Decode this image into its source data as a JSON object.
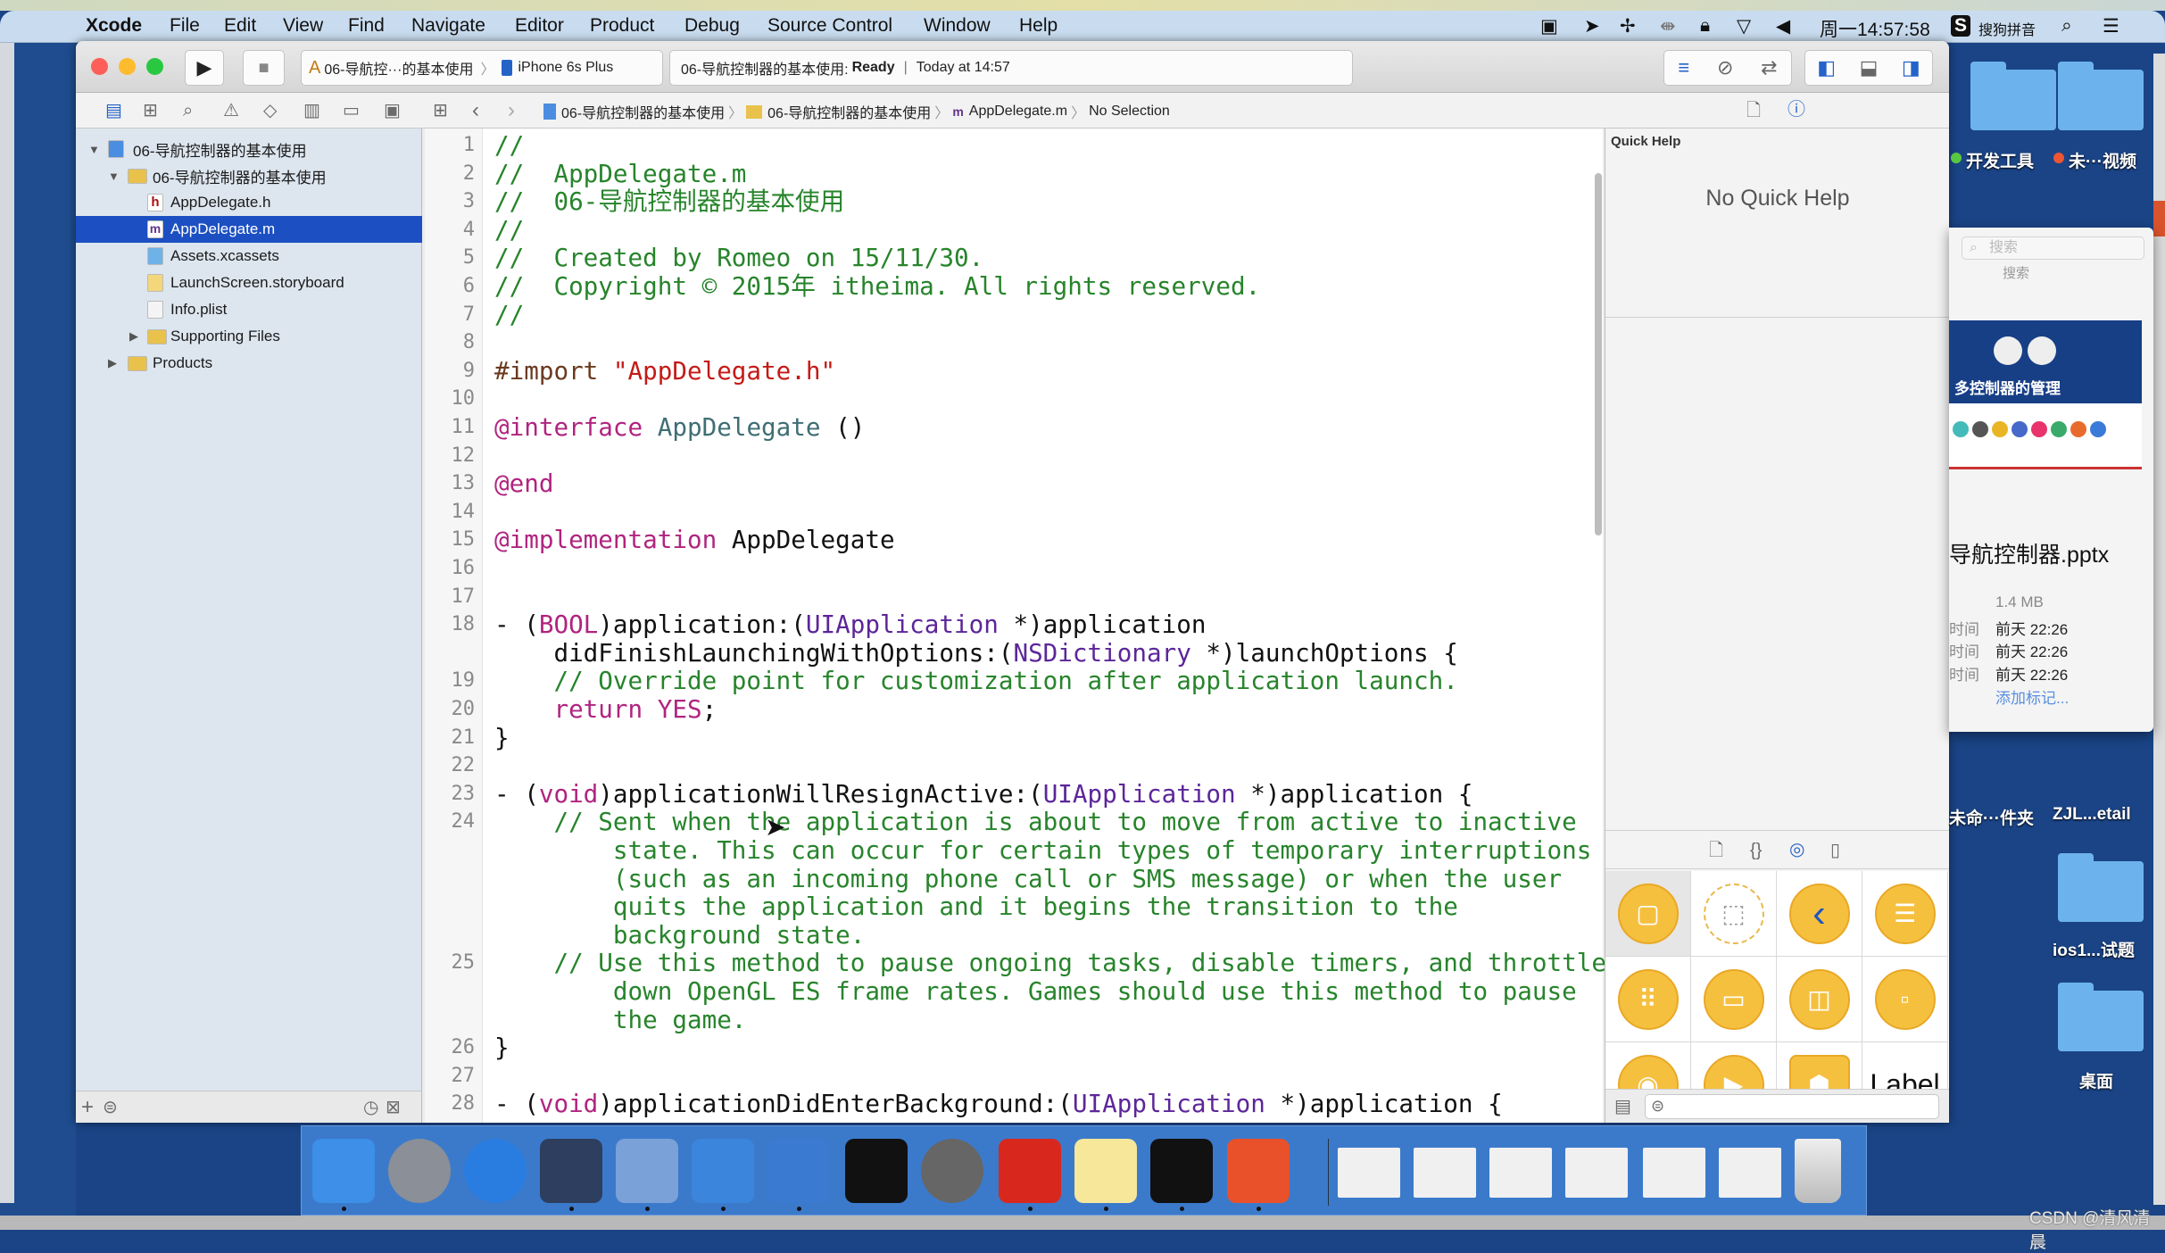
{
  "menubar": {
    "apple": "",
    "items": [
      "Xcode",
      "File",
      "Edit",
      "View",
      "Find",
      "Navigate",
      "Editor",
      "Product",
      "Debug",
      "Source Control",
      "Window",
      "Help"
    ],
    "clock": "周一14:57:58",
    "input_method": "搜狗拼音"
  },
  "toolbar": {
    "scheme": "06-导航控···的基本使用",
    "device": "iPhone 6s Plus",
    "status_project": "06-导航控制器的基本使用:",
    "status_state": "Ready",
    "status_time": "Today at 14:57"
  },
  "jumpbar": {
    "items": [
      "06-导航控制器的基本使用",
      "06-导航控制器的基本使用",
      "AppDelegate.m",
      "No Selection"
    ]
  },
  "navigator": {
    "items": [
      {
        "label": "06-导航控制器的基本使用",
        "level": 0,
        "icon": "project",
        "disclosure": "open"
      },
      {
        "label": "06-导航控制器的基本使用",
        "level": 1,
        "icon": "folder",
        "disclosure": "open"
      },
      {
        "label": "AppDelegate.h",
        "level": 2,
        "icon": "header-file"
      },
      {
        "label": "AppDelegate.m",
        "level": 2,
        "icon": "implementation-file",
        "selected": true
      },
      {
        "label": "Assets.xcassets",
        "level": 2,
        "icon": "assets"
      },
      {
        "label": "LaunchScreen.storyboard",
        "level": 2,
        "icon": "storyboard"
      },
      {
        "label": "Info.plist",
        "level": 2,
        "icon": "plist"
      },
      {
        "label": "Supporting Files",
        "level": 2,
        "icon": "folder",
        "disclosure": "closed"
      },
      {
        "label": "Products",
        "level": 1,
        "icon": "folder",
        "disclosure": "closed"
      }
    ],
    "selection_color": "#1c4fc2"
  },
  "editor": {
    "lines": [
      {
        "n": "1",
        "segs": [
          [
            "c",
            "//"
          ]
        ]
      },
      {
        "n": "2",
        "segs": [
          [
            "c",
            "//  AppDelegate.m"
          ]
        ]
      },
      {
        "n": "3",
        "segs": [
          [
            "c",
            "//  06-导航控制器的基本使用"
          ]
        ]
      },
      {
        "n": "4",
        "segs": [
          [
            "c",
            "//"
          ]
        ]
      },
      {
        "n": "5",
        "segs": [
          [
            "c",
            "//  Created by Romeo on 15/11/30."
          ]
        ]
      },
      {
        "n": "6",
        "segs": [
          [
            "c",
            "//  Copyright © 2015年 itheima. All rights reserved."
          ]
        ]
      },
      {
        "n": "7",
        "segs": [
          [
            "c",
            "//"
          ]
        ]
      },
      {
        "n": "8",
        "segs": []
      },
      {
        "n": "9",
        "segs": [
          [
            "p",
            "#import "
          ],
          [
            "s",
            "\"AppDelegate.h\""
          ]
        ]
      },
      {
        "n": "10",
        "segs": []
      },
      {
        "n": "11",
        "segs": [
          [
            "k",
            "@interface"
          ],
          [
            "x",
            " "
          ],
          [
            "i",
            "AppDelegate"
          ],
          [
            "x",
            " ()"
          ]
        ]
      },
      {
        "n": "12",
        "segs": []
      },
      {
        "n": "13",
        "segs": [
          [
            "k",
            "@end"
          ]
        ]
      },
      {
        "n": "14",
        "segs": []
      },
      {
        "n": "15",
        "segs": [
          [
            "k",
            "@implementation"
          ],
          [
            "x",
            " AppDelegate"
          ]
        ]
      },
      {
        "n": "16",
        "segs": []
      },
      {
        "n": "17",
        "segs": []
      },
      {
        "n": "18",
        "segs": [
          [
            "x",
            "- ("
          ],
          [
            "k",
            "BOOL"
          ],
          [
            "x",
            ")application:("
          ],
          [
            "t",
            "UIApplication"
          ],
          [
            "x",
            " *)application"
          ]
        ]
      },
      {
        "n": "",
        "segs": [
          [
            "x",
            "    didFinishLaunchingWithOptions:("
          ],
          [
            "t",
            "NSDictionary"
          ],
          [
            "x",
            " *)launchOptions {"
          ]
        ]
      },
      {
        "n": "19",
        "segs": [
          [
            "c",
            "    // Override point for customization after application launch."
          ]
        ]
      },
      {
        "n": "20",
        "segs": [
          [
            "x",
            "    "
          ],
          [
            "k",
            "return"
          ],
          [
            "x",
            " "
          ],
          [
            "k",
            "YES"
          ],
          [
            "x",
            ";"
          ]
        ]
      },
      {
        "n": "21",
        "segs": [
          [
            "x",
            "}"
          ]
        ]
      },
      {
        "n": "22",
        "segs": []
      },
      {
        "n": "23",
        "segs": [
          [
            "x",
            "- ("
          ],
          [
            "k",
            "void"
          ],
          [
            "x",
            ")applicationWillResignActive:("
          ],
          [
            "t",
            "UIApplication"
          ],
          [
            "x",
            " *)application {"
          ]
        ]
      },
      {
        "n": "24",
        "segs": [
          [
            "c",
            "    // Sent when the application is about to move from active to inactive"
          ]
        ]
      },
      {
        "n": "",
        "segs": [
          [
            "c",
            "        state. This can occur for certain types of temporary interruptions"
          ]
        ]
      },
      {
        "n": "",
        "segs": [
          [
            "c",
            "        (such as an incoming phone call or SMS message) or when the user"
          ]
        ]
      },
      {
        "n": "",
        "segs": [
          [
            "c",
            "        quits the application and it begins the transition to the"
          ]
        ]
      },
      {
        "n": "",
        "segs": [
          [
            "c",
            "        background state."
          ]
        ]
      },
      {
        "n": "25",
        "segs": [
          [
            "c",
            "    // Use this method to pause ongoing tasks, disable timers, and throttle"
          ]
        ]
      },
      {
        "n": "",
        "segs": [
          [
            "c",
            "        down OpenGL ES frame rates. Games should use this method to pause"
          ]
        ]
      },
      {
        "n": "",
        "segs": [
          [
            "c",
            "        the game."
          ]
        ]
      },
      {
        "n": "26",
        "segs": [
          [
            "x",
            "}"
          ]
        ]
      },
      {
        "n": "27",
        "segs": []
      },
      {
        "n": "28",
        "segs": [
          [
            "x",
            "- ("
          ],
          [
            "k",
            "void"
          ],
          [
            "x",
            ")applicationDidEnterBackground:("
          ],
          [
            "t",
            "UIApplication"
          ],
          [
            "x",
            " *)application {"
          ]
        ]
      }
    ]
  },
  "inspector": {
    "section_title": "Quick Help",
    "empty_text": "No Quick Help"
  },
  "library": {
    "items": [
      {
        "name": "view-controller",
        "glyph": "▢"
      },
      {
        "name": "storyboard-reference",
        "glyph": "⬚"
      },
      {
        "name": "navigation-controller",
        "glyph": "‹"
      },
      {
        "name": "table-view-controller",
        "glyph": "☰"
      },
      {
        "name": "collection-view-controller",
        "glyph": "⠿"
      },
      {
        "name": "tab-bar-controller",
        "glyph": "▭"
      },
      {
        "name": "split-view-controller",
        "glyph": "◫"
      },
      {
        "name": "page-view-controller",
        "glyph": "▫"
      },
      {
        "name": "glkit-view-controller",
        "glyph": "◉"
      },
      {
        "name": "av-player-view-controller",
        "glyph": "▶"
      },
      {
        "name": "object",
        "glyph": "⬢"
      },
      {
        "name": "label",
        "glyph": "Label"
      }
    ]
  },
  "desktop": {
    "folders_top": [
      {
        "label": "开发工具",
        "tag": "#59c840"
      },
      {
        "label": "未···视频",
        "tag": "#ee5533"
      }
    ],
    "quicklook": {
      "search_placeholder": "搜索",
      "search_caption": "搜索",
      "banner_title": "多控制器的管理",
      "filename": "导航控制器.pptx",
      "size": "1.4 MB",
      "dates": [
        {
          "label": "时间",
          "value": "前天 22:26"
        },
        {
          "label": "时间",
          "value": "前天 22:26"
        },
        {
          "label": "时间",
          "value": "前天 22:26"
        }
      ],
      "add_tag": "添加标记..."
    },
    "labels_mid": [
      "未命···件夹",
      "ZJL...etail"
    ],
    "folders_bottom": [
      "ios1...试题",
      "桌面"
    ]
  },
  "dock": {
    "apps": [
      "finder",
      "launchpad",
      "safari",
      "mouse-app",
      "photo-booth",
      "xcode",
      "instruments",
      "terminal",
      "system-preferences",
      "xmind",
      "notes",
      "console",
      "wps"
    ],
    "running": [
      true,
      false,
      false,
      true,
      true,
      true,
      true,
      false,
      false,
      true,
      true,
      true,
      true
    ],
    "minimized": [
      "window-1",
      "window-2",
      "window-3",
      "window-4",
      "window-5",
      "window-6"
    ],
    "trash": "trash"
  },
  "watermark": "CSDN @清风清晨"
}
